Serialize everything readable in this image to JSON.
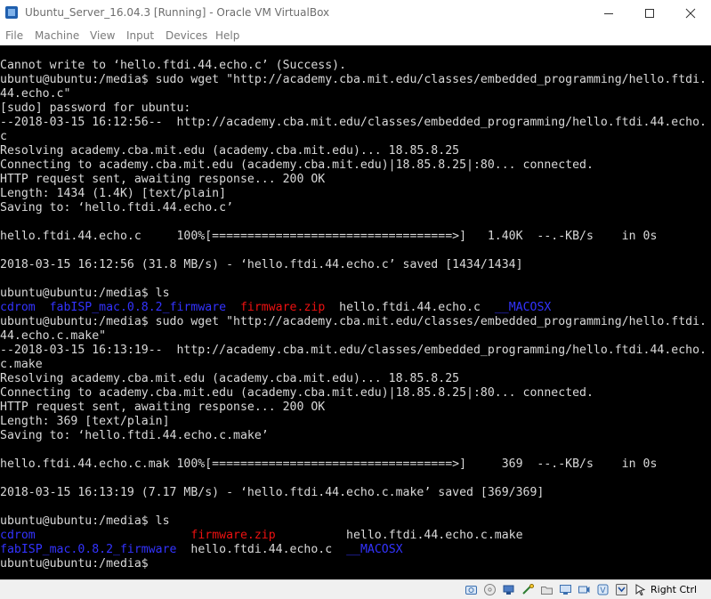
{
  "window": {
    "title": "Ubuntu_Server_16.04.3 [Running] - Oracle VM VirtualBox"
  },
  "menu": [
    "File",
    "Machine",
    "View",
    "Input",
    "Devices",
    "Help"
  ],
  "terminal": {
    "lines": [
      [
        {
          "t": "Cannot write to ‘hello.ftdi.44.echo.c’ (Success)."
        }
      ],
      [
        {
          "t": "ubuntu@ubuntu:/media$ sudo wget \"http://academy.cba.mit.edu/classes/embedded_programming/hello.ftdi."
        }
      ],
      [
        {
          "t": "44.echo.c\""
        }
      ],
      [
        {
          "t": "[sudo] password for ubuntu:"
        }
      ],
      [
        {
          "t": "--2018-03-15 16:12:56--  http://academy.cba.mit.edu/classes/embedded_programming/hello.ftdi.44.echo."
        }
      ],
      [
        {
          "t": "c"
        }
      ],
      [
        {
          "t": "Resolving academy.cba.mit.edu (academy.cba.mit.edu)... 18.85.8.25"
        }
      ],
      [
        {
          "t": "Connecting to academy.cba.mit.edu (academy.cba.mit.edu)|18.85.8.25|:80... connected."
        }
      ],
      [
        {
          "t": "HTTP request sent, awaiting response... 200 OK"
        }
      ],
      [
        {
          "t": "Length: 1434 (1.4K) [text/plain]"
        }
      ],
      [
        {
          "t": "Saving to: ‘hello.ftdi.44.echo.c’"
        }
      ],
      [
        {
          "t": ""
        }
      ],
      [
        {
          "t": "hello.ftdi.44.echo.c     100%[==================================>]   1.40K  --.-KB/s    in 0s"
        }
      ],
      [
        {
          "t": ""
        }
      ],
      [
        {
          "t": "2018-03-15 16:12:56 (31.8 MB/s) - ‘hello.ftdi.44.echo.c’ saved [1434/1434]"
        }
      ],
      [
        {
          "t": ""
        }
      ],
      [
        {
          "t": "ubuntu@ubuntu:/media$ ls"
        }
      ],
      [
        {
          "t": "cdrom",
          "c": "blue"
        },
        {
          "t": "  "
        },
        {
          "t": "fabISP_mac.0.8.2_firmware",
          "c": "blue"
        },
        {
          "t": "  "
        },
        {
          "t": "firmware.zip",
          "c": "red"
        },
        {
          "t": "  hello.ftdi.44.echo.c  "
        },
        {
          "t": "__MACOSX",
          "c": "blue"
        }
      ],
      [
        {
          "t": "ubuntu@ubuntu:/media$ sudo wget \"http://academy.cba.mit.edu/classes/embedded_programming/hello.ftdi."
        }
      ],
      [
        {
          "t": "44.echo.c.make\""
        }
      ],
      [
        {
          "t": "--2018-03-15 16:13:19--  http://academy.cba.mit.edu/classes/embedded_programming/hello.ftdi.44.echo."
        }
      ],
      [
        {
          "t": "c.make"
        }
      ],
      [
        {
          "t": "Resolving academy.cba.mit.edu (academy.cba.mit.edu)... 18.85.8.25"
        }
      ],
      [
        {
          "t": "Connecting to academy.cba.mit.edu (academy.cba.mit.edu)|18.85.8.25|:80... connected."
        }
      ],
      [
        {
          "t": "HTTP request sent, awaiting response... 200 OK"
        }
      ],
      [
        {
          "t": "Length: 369 [text/plain]"
        }
      ],
      [
        {
          "t": "Saving to: ‘hello.ftdi.44.echo.c.make’"
        }
      ],
      [
        {
          "t": ""
        }
      ],
      [
        {
          "t": "hello.ftdi.44.echo.c.mak 100%[==================================>]     369  --.-KB/s    in 0s"
        }
      ],
      [
        {
          "t": ""
        }
      ],
      [
        {
          "t": "2018-03-15 16:13:19 (7.17 MB/s) - ‘hello.ftdi.44.echo.c.make’ saved [369/369]"
        }
      ],
      [
        {
          "t": ""
        }
      ],
      [
        {
          "t": "ubuntu@ubuntu:/media$ ls"
        }
      ],
      [
        {
          "t": "cdrom",
          "c": "blue"
        },
        {
          "t": "                      "
        },
        {
          "t": "firmware.zip",
          "c": "red"
        },
        {
          "t": "          hello.ftdi.44.echo.c.make"
        }
      ],
      [
        {
          "t": "fabISP_mac.0.8.2_firmware",
          "c": "blue"
        },
        {
          "t": "  hello.ftdi.44.echo.c  "
        },
        {
          "t": "__MACOSX",
          "c": "blue"
        }
      ],
      [
        {
          "t": "ubuntu@ubuntu:/media$ "
        },
        {
          "t": "",
          "cursor": true
        }
      ]
    ]
  },
  "statusbar": {
    "icons": [
      "hard-disk-icon",
      "optical-drive-icon",
      "usb-icon",
      "network-icon",
      "shared-folders-icon",
      "display-icon",
      "video-capture-icon",
      "capture-icon",
      "keyboard-icon",
      "mouse-integration-icon"
    ],
    "host_key": "Right Ctrl"
  },
  "colors": {
    "terminal_bg": "#000000",
    "terminal_fg": "#d9d9d9",
    "dir_blue": "#3333ff",
    "archive_red": "#ee1111"
  }
}
